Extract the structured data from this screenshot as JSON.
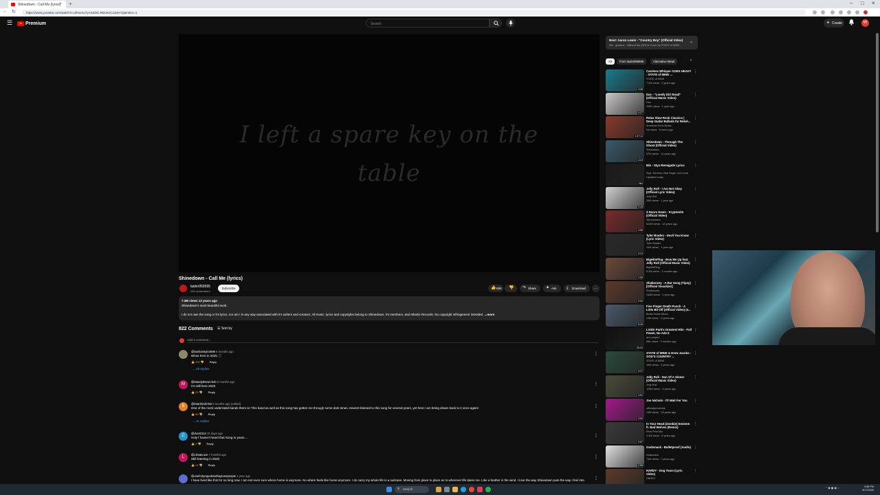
{
  "browser": {
    "tab_title": "Shinedown - Call Me (lyrics)",
    "url": "https://www.youtube.com/watch?v=ZhneSx7yAK&list=RDoKnC1duH7Q&index=1"
  },
  "header": {
    "logo_text": "Premium",
    "search_placeholder": "Search",
    "create_label": "Create",
    "avatar_letter": "W"
  },
  "player": {
    "lyric_line1": "I left a spare key on the",
    "lyric_line2": "table"
  },
  "video": {
    "title": "Shinedown - Call Me (lyrics)",
    "channel": "laider959595",
    "subscribers": "14K subscribers",
    "subscribe_label": "Subscribe",
    "likes": "60K",
    "share_label": "Share",
    "ask_label": "Ask",
    "download_label": "Download",
    "description_meta": "7.3M views  13 years ago",
    "description_line1": "Shinedown's most beautiful work.",
    "description_line2": "I do not own the song or it's lyrics, nor am I in any way associated with it's writers and creators. All music, lyrics and copyrights belong to Shinedown, it's members, and Atlantic Records. No copyright infringement intended.",
    "more_label": "...more"
  },
  "comments_section": {
    "count_label": "822 Comments",
    "sort_label": "Sort by",
    "add_placeholder": "Add a comment...",
    "comments": [
      {
        "author": "@bamlarstyle2696",
        "time": "6 months ago",
        "text": "Whos here in 2025 🎵",
        "likes": "332",
        "reply": "Reply",
        "replies": "48 replies",
        "avatar_color": "#8a8a6a",
        "avatar_letter": ""
      },
      {
        "author": "@MandyBrown-kvb",
        "time": "6 months ago",
        "text": "I'm still here 2025",
        "likes": "23",
        "reply": "Reply",
        "replies": "",
        "avatar_color": "#c2185b",
        "avatar_letter": "M"
      },
      {
        "author": "@brianford1782",
        "time": "5 months ago (edited)",
        "text": "One of the most underrated bands there is! This band as well as this song has gotten me through some dark times. Havent listened to this song for several years, yet here I am being drawn back to it once again!",
        "likes": "90",
        "reply": "Reply",
        "replies": "11 replies",
        "avatar_color": "#e67e22",
        "avatar_letter": "B"
      },
      {
        "author": "@cks42114",
        "time": "15 days ago",
        "text": "Holy f haven't heard that Song in years....",
        "likes": "3",
        "reply": "Reply",
        "replies": "",
        "avatar_color": "#2196c9",
        "avatar_letter": "C"
      },
      {
        "author": "@LilmatLove",
        "time": "7 months ago",
        "text": "Still listening in 2025",
        "likes": "14",
        "reply": "Reply",
        "replies": "",
        "avatar_color": "#c2185b",
        "avatar_letter": "L"
      },
      {
        "author": "@onefortyequalsnothaytunepeople",
        "time": "1 year ago",
        "text": "I have lived like this for so long now. I am not even sure where home is anymore. No where feels like home anymore. I do carry my whole life in a suitcase. Moving from place to place as to wherever life takes me. Like a feather in the wind. I love the way Shinedown puts the way I feel into",
        "likes": "",
        "reply": "",
        "replies": "",
        "avatar_color": "#5a6fd1",
        "avatar_letter": ""
      }
    ]
  },
  "sidebar": {
    "next_title": "Next: Aaron Lewis - \"Country Boy\" (Official Video)",
    "next_sub": "Mix - ghalsne - Without Me (ROCK Cover by STATE of MINE ...",
    "chips": [
      "All",
      "From laider959595",
      "Alternative Metal"
    ],
    "recommendations": [
      {
        "title": "Careless Whisper GOES HEAVY - STATE of MINE ...",
        "channel": "STATE of MINE",
        "meta": "7.2M views · 2 years ago",
        "duration": "4:38",
        "thumb": "#1c7a8c"
      },
      {
        "title": "Dax - \"Lonely Dirt Road\" (Official Music Video)",
        "channel": "Dax",
        "meta": "295K views · 1 year ago",
        "duration": "4:27",
        "thumb": "#c9c9c9"
      },
      {
        "title": "Relax Slow Rock Classics | Deep Guitar Ballads for Rebel...",
        "channel": "American Echo Beats",
        "meta": "No views · 6 hours ago",
        "duration": "1:47:11",
        "thumb": "#8a3a2a"
      },
      {
        "title": "Shinedown - Through The Ghost (Official Video)",
        "channel": "Shinedown",
        "meta": "37M views · 11 years ago",
        "duration": "4:23",
        "thumb": "#3a5a6a"
      },
      {
        "title": "Mix - Styx-Renegade Lyrics",
        "channel": "Styx, Survivor, Bob Seger, and more",
        "meta": "Updated today",
        "duration": "Mix",
        "thumb": "#1a1a1a"
      },
      {
        "title": "Jelly Roll - I Am Not Okay (Official Lyric Video)",
        "channel": "Jelly Roll",
        "meta": "26M views · 1 year ago",
        "duration": "3:18",
        "thumb": "#d0d0d0"
      },
      {
        "title": "3 Doors Down - Kryptonite (Official Video)",
        "channel": "3doorsdown",
        "meta": "522M views · 15 years ago",
        "duration": "3:55",
        "thumb": "#7a2a2a"
      },
      {
        "title": "Tyler Braden - Devil You Know (Lyric Video)",
        "channel": "Tyler Braden",
        "meta": "19M views · 1 year ago",
        "duration": "3:13",
        "thumb": "#2a2a2a"
      },
      {
        "title": "BigHitsPlug - Bow Me Up feat. Jelly Roll (Official Music Video)",
        "channel": "BigHitsPlug",
        "meta": "5.3M views · 2 months ago",
        "duration": "2:59",
        "thumb": "#6a4a3a"
      },
      {
        "title": "Shaboozey - A Bar Song (Tipsy) [Official Visualizer]",
        "channel": "Shaboozey",
        "meta": "245M views · 1 year ago",
        "duration": "2:54",
        "thumb": "#5a3a2a"
      },
      {
        "title": "Five Finger Death Punch - A Little Bit Off (Official Video) (4...",
        "channel": "Better Noise Music",
        "meta": "13M views · 5 years ago",
        "duration": "5:16",
        "thumb": "#4a5a6a"
      },
      {
        "title": "Linkin Park's Greatest Hits - Full Power, No Ads II",
        "channel": "arm.project",
        "meta": "68K views · 3 months ago",
        "duration": "25:04",
        "thumb": "#111111"
      },
      {
        "title": "STATE of MINE & Drew Jacobs - GOD'S COUNTRY ...",
        "channel": "STATE of MINE",
        "meta": "16M views · 3 years ago",
        "duration": "3:27",
        "thumb": "#2a4a3a"
      },
      {
        "title": "Jelly Roll - Son Of A Sinner (Official Music Video)",
        "channel": "Jelly Roll",
        "meta": "125M views · 3 years ago",
        "duration": "3:51",
        "thumb": "#4a4a3a"
      },
      {
        "title": "Joe Nichols - I'll Wait For You",
        "channel": "officialjoenichols",
        "meta": "14M views · 16 years ago",
        "duration": "3:53",
        "thumb": "#a21a8a"
      },
      {
        "title": "In Your Head (Zombie) Eminem ft. Bad Wolves (Remix)",
        "channel": "Elvis Print Mix",
        "meta": "3.4M views · 6 years ago",
        "duration": "3:57",
        "thumb": "#3a3a3a"
      },
      {
        "title": "Godsmack - Bulletproof (Audio)",
        "channel": "Godsmack",
        "meta": "74M views · 7 years ago",
        "duration": "2:58",
        "thumb": "#e0e0e0"
      },
      {
        "title": "HARDY - Dog Years (Lyric Video)",
        "channel": "HARDY",
        "meta": "",
        "duration": "",
        "thumb": "#5a3a2a"
      }
    ]
  },
  "taskbar": {
    "search_label": "Search",
    "time": "4:36 PM",
    "date": "3/17/2025"
  }
}
